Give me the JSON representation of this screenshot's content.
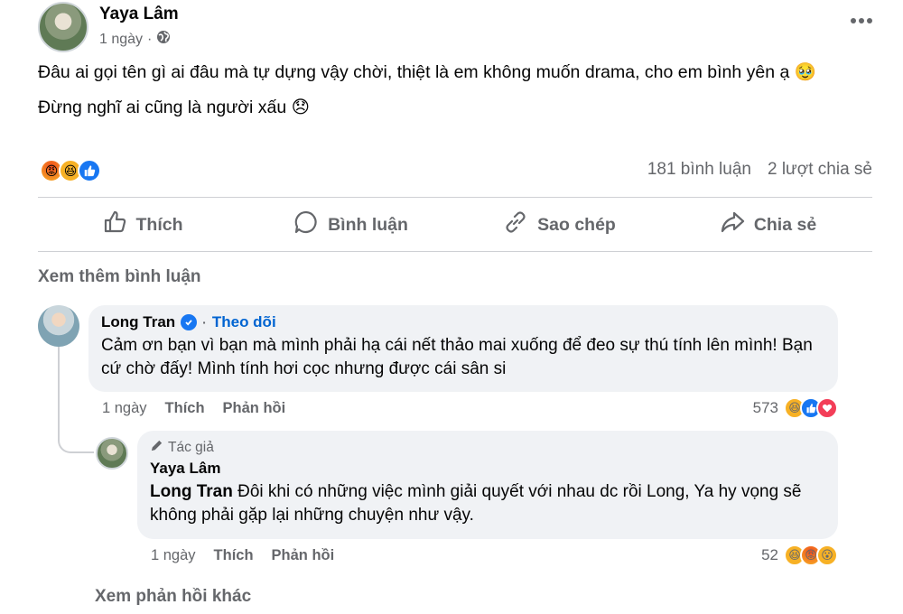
{
  "post": {
    "author": "Yaya Lâm",
    "time": "1 ngày",
    "separator": "·",
    "paragraph1": "Đâu ai gọi tên gì ai đâu mà tự dựng vậy chời, thiệt là em không muốn drama, cho em bình yên ạ 🥹",
    "paragraph2": "Đừng nghĩ ai cũng là người xấu 😞",
    "comment_count": "181 bình luận",
    "share_count": "2 lượt chia sẻ"
  },
  "actions": {
    "like": "Thích",
    "comment": "Bình luận",
    "copy": "Sao chép",
    "share": "Chia sẻ"
  },
  "more_comments": "Xem thêm bình luận",
  "comment1": {
    "author": "Long Tran",
    "separator": "·",
    "follow": "Theo dõi",
    "text": "Cảm ơn bạn vì bạn mà mình phải hạ cái nết thảo mai xuống để đeo sự thú tính lên mình! Bạn cứ chờ đấy! Mình tính hơi cọc nhưng được cái sân si",
    "time": "1 ngày",
    "like": "Thích",
    "reply": "Phản hồi",
    "reactions": "573"
  },
  "reply1": {
    "badge": "Tác giả",
    "author": "Yaya Lâm",
    "mention": "Long Tran",
    "text": " Đôi khi có những việc mình giải quyết với nhau dc rồi Long, Ya hy vọng sẽ không phải gặp lại những chuyện như vậy.",
    "time": "1 ngày",
    "like": "Thích",
    "reply": "Phản hồi",
    "reactions": "52"
  },
  "more_replies": "Xem phản hồi khác",
  "icons": {
    "post_reactions": [
      "angry",
      "haha",
      "like"
    ],
    "comment1_reactions": [
      "haha",
      "like",
      "love"
    ],
    "reply1_reactions": [
      "haha",
      "angry",
      "wow"
    ]
  },
  "colors": {
    "link": "#0064d1",
    "muted": "#65676b",
    "bubble": "#f0f2f5"
  }
}
